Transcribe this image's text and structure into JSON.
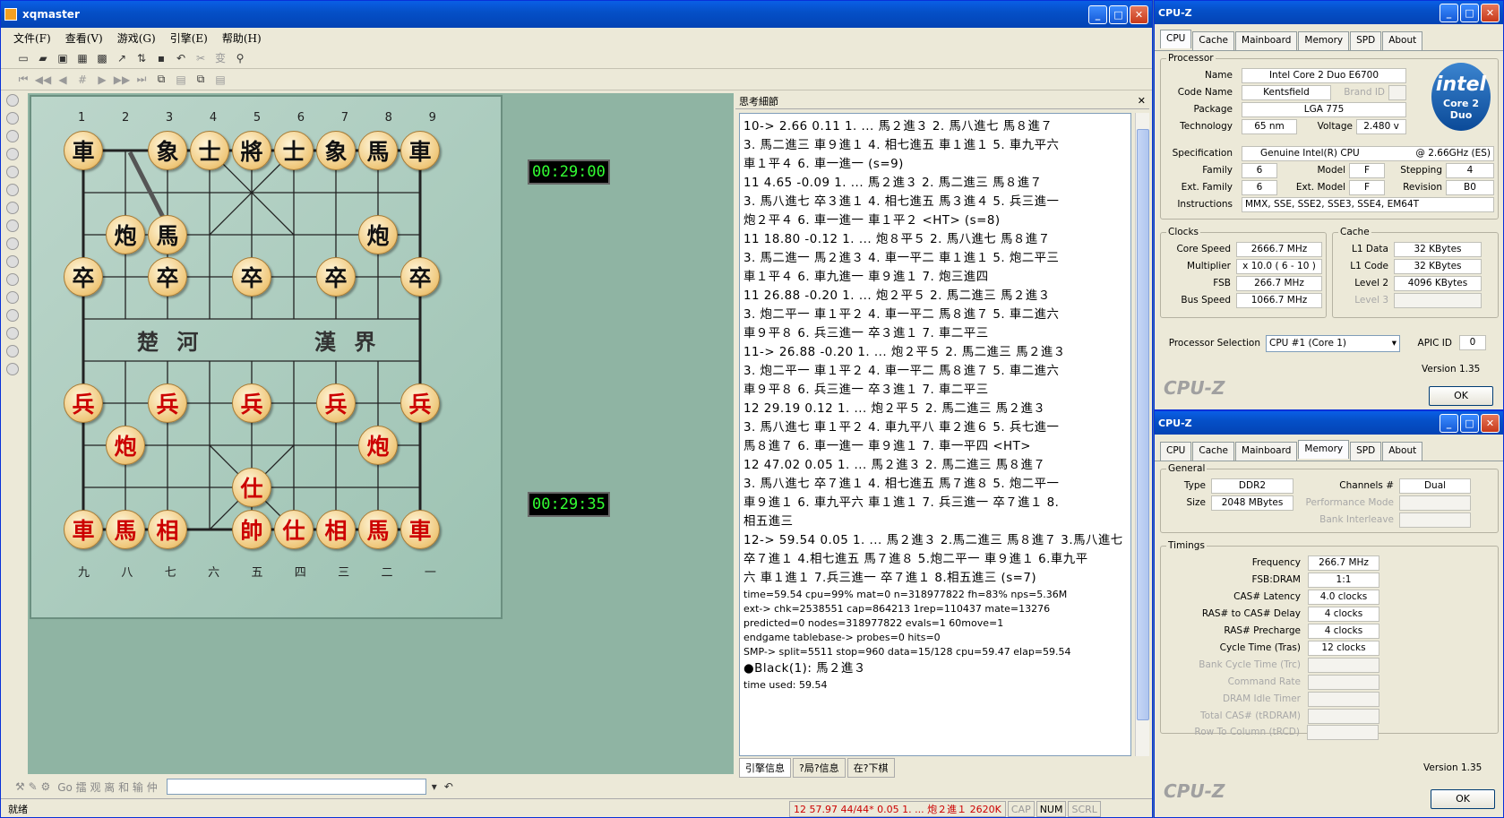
{
  "xq": {
    "title": "xqmaster",
    "menu": [
      "文件(F)",
      "查看(V)",
      "游戏(G)",
      "引擎(E)",
      "帮助(H)"
    ],
    "files_top": [
      "1",
      "2",
      "3",
      "4",
      "5",
      "6",
      "7",
      "8",
      "9"
    ],
    "files_bottom": [
      "九",
      "八",
      "七",
      "六",
      "五",
      "四",
      "三",
      "二",
      "一"
    ],
    "river_left": "楚 河",
    "river_right": "漢 界",
    "timer_top": "00:29:00",
    "timer_bottom": "00:29:35",
    "pieces_black": [
      "車",
      "象",
      "士",
      "將",
      "士",
      "象",
      "馬",
      "車",
      "炮",
      "馬",
      "炮",
      "卒",
      "卒",
      "卒",
      "卒",
      "卒"
    ],
    "pieces_red": [
      "兵",
      "兵",
      "兵",
      "兵",
      "兵",
      "炮",
      "炮",
      "仕",
      "車",
      "馬",
      "相",
      "帥",
      "仕",
      "相",
      "馬",
      "車"
    ],
    "panel_title": "思考細節",
    "panel_close": "✕",
    "think_lines": [
      "10->   2.66   0.11   1. ... 馬２進３  2. 馬八進七 馬８進７",
      "3. 馬二進三 車９進１  4. 相七進五 車１進１  5. 車九平六",
      "車１平４  6. 車一進一 (s=9)",
      "11    4.65  -0.09   1. ... 馬２進３  2. 馬二進三 馬８進７",
      "3. 馬八進七 卒３進１  4. 相七進五 馬３進４  5. 兵三進一",
      "炮２平４  6. 車一進一 車１平２ <HT> (s=8)",
      "11   18.80  -0.12   1. ... 炮８平５  2. 馬八進七 馬８進７",
      "3. 馬二進一 馬２進３  4. 車一平二 車１進１  5. 炮二平三",
      "車１平４  6. 車九進一 車９進１  7. 炮三進四",
      "11   26.88  -0.20   1. ... 炮２平５  2. 馬二進三 馬２進３",
      "3. 炮二平一 車１平２  4. 車一平二 馬８進７  5. 車二進六",
      "車９平８  6. 兵三進一 卒３進１  7. 車二平三",
      "11->  26.88  -0.20   1. ... 炮２平５  2. 馬二進三 馬２進３",
      "3. 炮二平一 車１平２  4. 車一平二 馬８進７  5. 車二進六",
      "車９平８  6. 兵三進一 卒３進１  7. 車二平三",
      "12   29.19   0.12   1. ... 炮２平５  2. 馬二進三 馬２進３",
      "3. 馬八進七 車１平２  4. 車九平八 車２進６  5. 兵七進一",
      "馬８進７  6. 車一進一 車９進１  7. 車一平四 <HT>",
      "12   47.02   0.05   1. ... 馬２進３  2. 馬二進三 馬８進７",
      "3. 馬八進七 卒７進１  4. 相七進五 馬７進８  5. 炮二平一",
      "車９進１  6. 車九平六 車１進１  7. 兵三進一 卒７進１  8.",
      "相五進三",
      "12-> 59.54  0.05  1. ... 馬２進３ 2.馬二進三 馬８進７ 3.馬八進七",
      "卒７進１ 4.相七進五 馬７進８ 5.炮二平一 車９進１ 6.車九平",
      "六 車１進１ 7.兵三進一 卒７進１ 8.相五進三 (s=7)"
    ],
    "stat_lines": [
      "time=59.54  cpu=99%  mat=0  n=318977822  fh=83%  nps=5.36M",
      "ext-> chk=2538551 cap=864213 1rep=110437 mate=13276",
      "predicted=0  nodes=318977822  evals=1  60move=1",
      "endgame tablebase-> probes=0  hits=0",
      "SMP-> split=5511  stop=960  data=15/128  cpu=59.47  elap=59.54"
    ],
    "result_line": "●Black(1): 馬２進３",
    "time_used": "time used:  59.54",
    "panel_tabs": [
      "引擎信息",
      "?局?信息",
      "在?下棋"
    ],
    "bottom_text": "Go  擂 观 离 和 输 仲",
    "status_ready": "就绪",
    "status_move": "12   57.97  44/44*   0.05  1. ... 炮２進１  2620K",
    "status_cap": "CAP",
    "status_num": "NUM",
    "status_scrl": "SCRL"
  },
  "cpuz1": {
    "title": "CPU-Z",
    "tabs": [
      "CPU",
      "Cache",
      "Mainboard",
      "Memory",
      "SPD",
      "About"
    ],
    "processor_group": "Processor",
    "name_label": "Name",
    "name_value": "Intel Core 2 Duo E6700",
    "codename_label": "Code Name",
    "codename_value": "Kentsfield",
    "brandid_label": "Brand ID",
    "package_label": "Package",
    "package_value": "LGA 775",
    "tech_label": "Technology",
    "tech_value": "65 nm",
    "voltage_label": "Voltage",
    "voltage_value": "2.480 v",
    "spec_label": "Specification",
    "spec_value": "Genuine Intel(R) CPU",
    "spec_freq": "@ 2.66GHz (ES)",
    "family_label": "Family",
    "family_value": "6",
    "model_label": "Model",
    "model_value": "F",
    "stepping_label": "Stepping",
    "stepping_value": "4",
    "extfamily_label": "Ext. Family",
    "extfamily_value": "6",
    "extmodel_label": "Ext. Model",
    "extmodel_value": "F",
    "revision_label": "Revision",
    "revision_value": "B0",
    "instr_label": "Instructions",
    "instr_value": "MMX, SSE, SSE2, SSE3, SSE4, EM64T",
    "clocks_group": "Clocks",
    "corespeed_label": "Core Speed",
    "corespeed_value": "2666.7 MHz",
    "multiplier_label": "Multiplier",
    "multiplier_value": "x 10.0  ( 6 - 10 )",
    "fsb_label": "FSB",
    "fsb_value": "266.7 MHz",
    "busspeed_label": "Bus Speed",
    "busspeed_value": "1066.7 MHz",
    "cache_group": "Cache",
    "l1data_label": "L1 Data",
    "l1data_value": "32 KBytes",
    "l1code_label": "L1 Code",
    "l1code_value": "32 KBytes",
    "level2_label": "Level 2",
    "level2_value": "4096 KBytes",
    "level3_label": "Level 3",
    "procsel_label": "Processor Selection",
    "procsel_value": "CPU #1 (Core 1)",
    "apicid_label": "APIC ID",
    "apicid_value": "0",
    "version": "Version 1.35",
    "logo": "CPU-Z",
    "ok": "OK",
    "intel_text": "intel",
    "intel_sub": "Core 2 Duo"
  },
  "cpuz2": {
    "title": "CPU-Z",
    "tabs": [
      "CPU",
      "Cache",
      "Mainboard",
      "Memory",
      "SPD",
      "About"
    ],
    "general_group": "General",
    "type_label": "Type",
    "type_value": "DDR2",
    "size_label": "Size",
    "size_value": "2048 MBytes",
    "channels_label": "Channels #",
    "channels_value": "Dual",
    "perfmode_label": "Performance Mode",
    "bankint_label": "Bank Interleave",
    "timings_group": "Timings",
    "freq_label": "Frequency",
    "freq_value": "266.7 MHz",
    "fsbdram_label": "FSB:DRAM",
    "fsbdram_value": "1:1",
    "cas_label": "CAS# Latency",
    "cas_value": "4.0 clocks",
    "rcd_label": "RAS# to CAS# Delay",
    "rcd_value": "4 clocks",
    "rp_label": "RAS# Precharge",
    "rp_value": "4 clocks",
    "tras_label": "Cycle Time (Tras)",
    "tras_value": "12 clocks",
    "trc_label": "Bank Cycle Time (Trc)",
    "cmdrate_label": "Command Rate",
    "idle_label": "DRAM Idle Timer",
    "trdram_label": "Total CAS# (tRDRAM)",
    "trcd_label": "Row To Column (tRCD)",
    "version": "Version 1.35",
    "logo": "CPU-Z",
    "ok": "OK"
  }
}
